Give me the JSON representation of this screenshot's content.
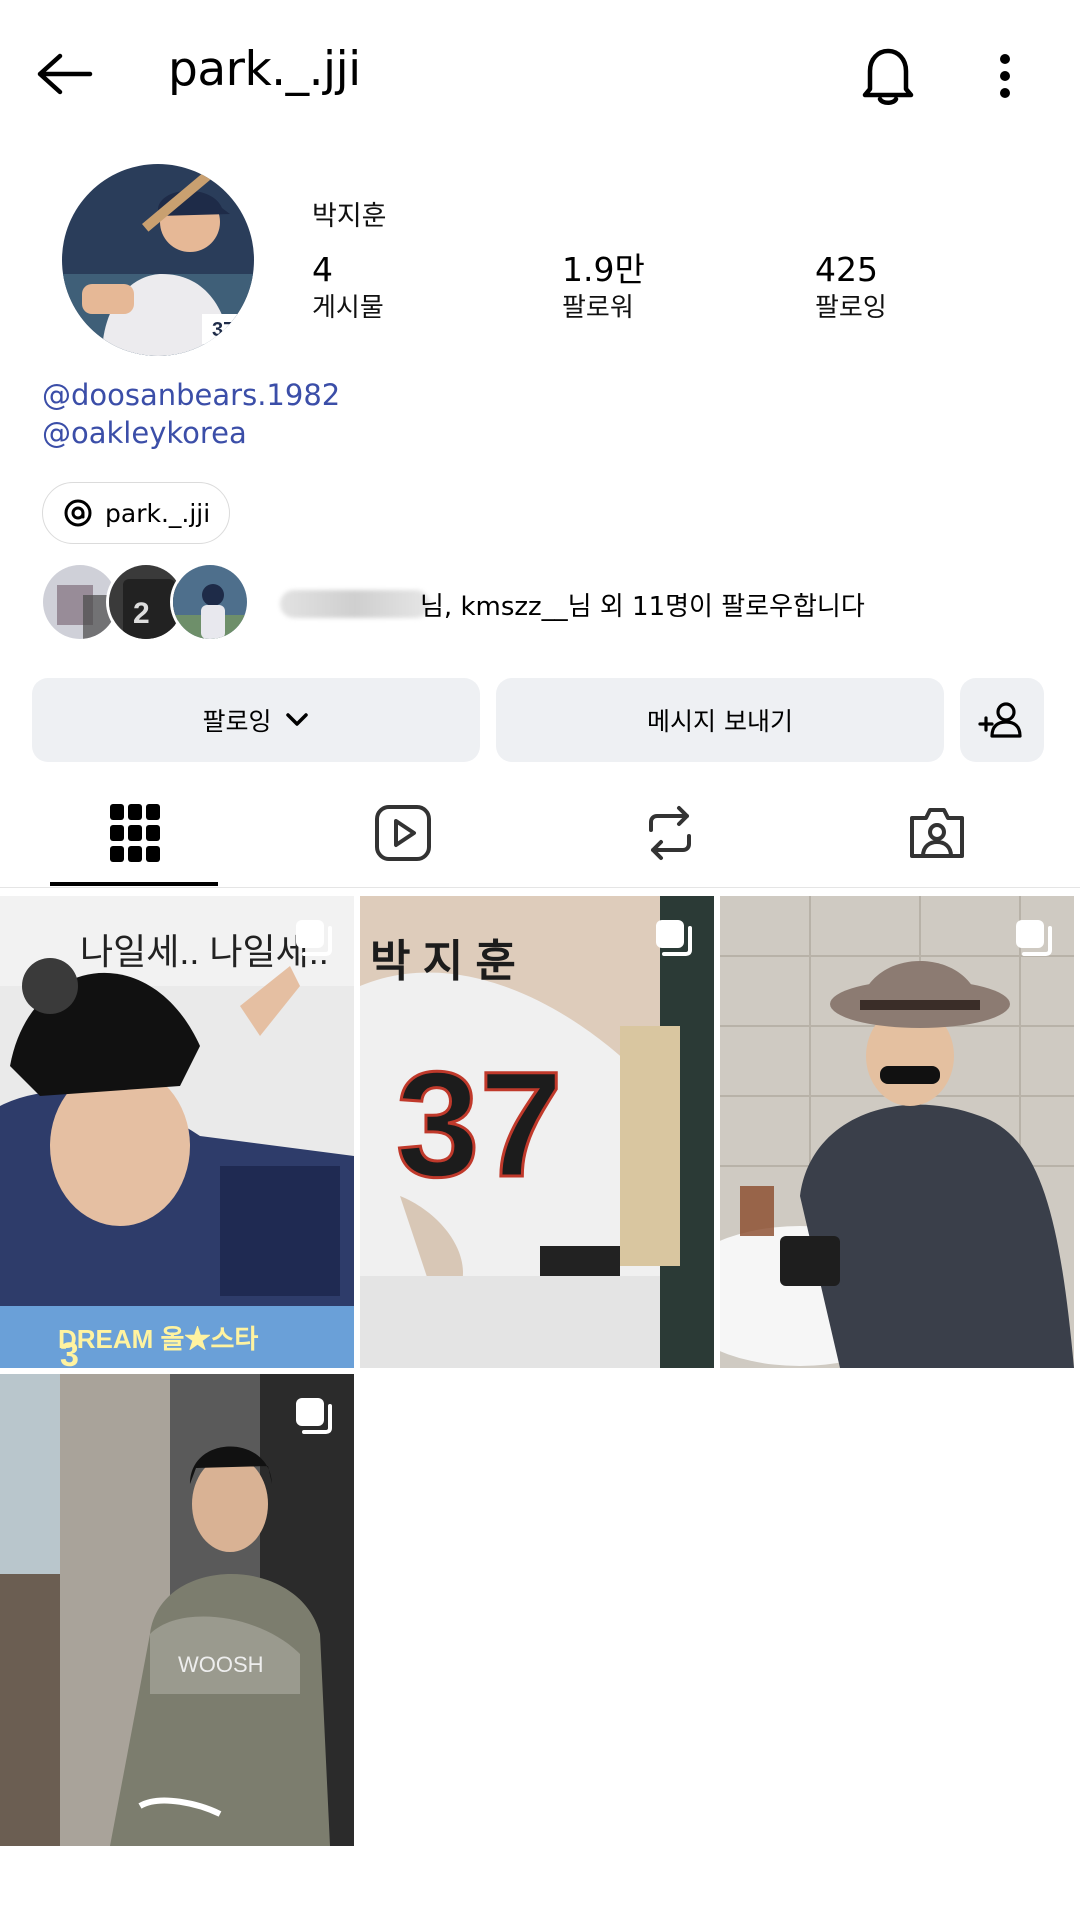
{
  "header": {
    "username": "park._.jji",
    "back_icon": "arrow-left-icon",
    "bell_icon": "bell-icon",
    "more_icon": "more-vertical-icon"
  },
  "profile": {
    "full_name": "박지훈",
    "stats": [
      {
        "value": "4",
        "label": "게시물"
      },
      {
        "value": "1.9만",
        "label": "팔로워"
      },
      {
        "value": "425",
        "label": "팔로잉"
      }
    ],
    "bio_links": [
      "@doosanbears.1982",
      "@oakleykorea"
    ],
    "threads_handle": "park._.jji",
    "followed_by_text": "님, kmszz__님 외 11명이 팔로우합니다"
  },
  "actions": {
    "following_label": "팔로잉",
    "message_label": "메시지 보내기",
    "add_person_icon": "person-add-icon"
  },
  "tabs": [
    {
      "name": "posts",
      "icon": "grid-icon",
      "active": true
    },
    {
      "name": "reels",
      "icon": "reels-icon",
      "active": false
    },
    {
      "name": "reposts",
      "icon": "repost-icon",
      "active": false
    },
    {
      "name": "tagged",
      "icon": "tagged-person-icon",
      "active": false
    }
  ],
  "posts": [
    {
      "overlay_text_top": "나일세.. 나일세..",
      "overlay_text_bottom": "DREAM 올★스타",
      "badge_number": "3",
      "multi": true
    },
    {
      "jersey_name": "박 지 훈",
      "jersey_number": "37",
      "multi": true
    },
    {
      "multi": true
    },
    {
      "hoodie_text": "WOOSH",
      "multi": true
    }
  ],
  "colors": {
    "link": "#3b4ea8",
    "button_bg": "#eef0f3",
    "jersey_number": "#1c1c1c"
  }
}
